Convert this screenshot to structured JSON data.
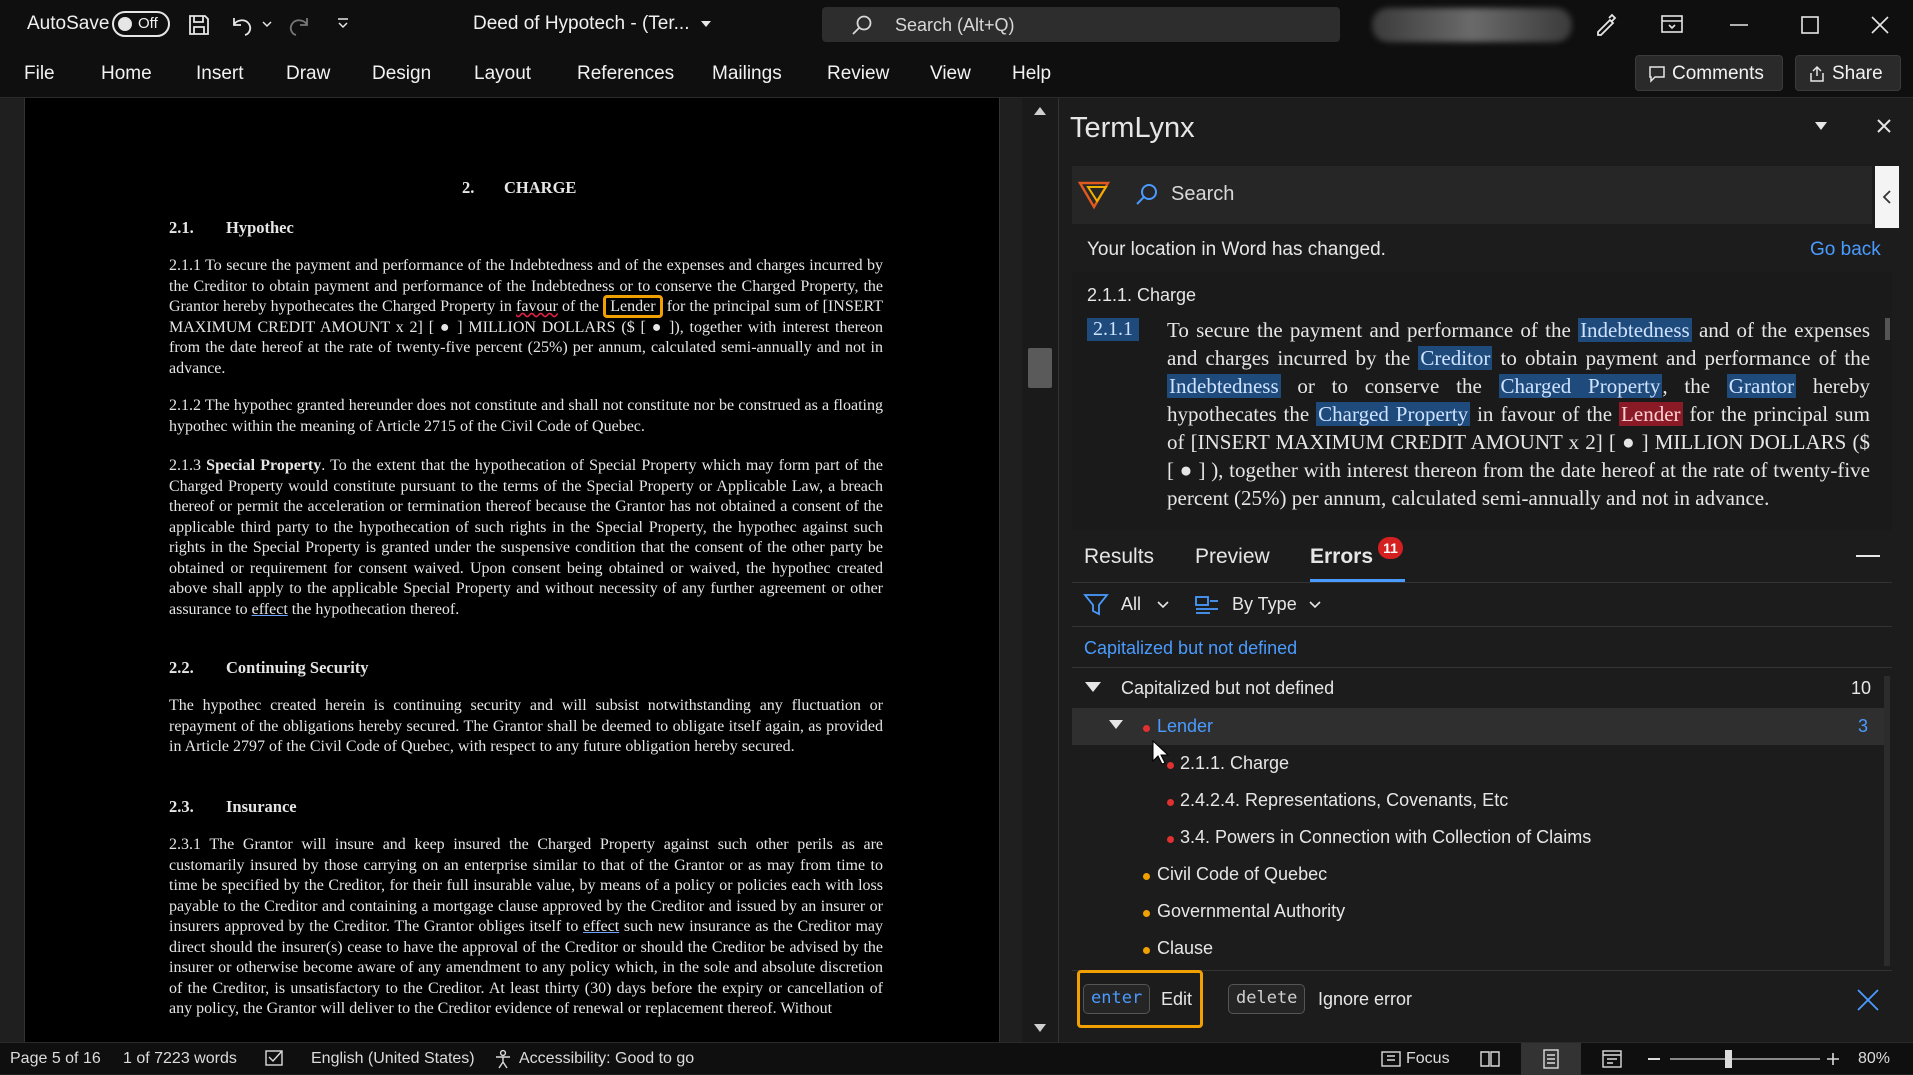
{
  "titlebar": {
    "autosave_label": "AutoSave",
    "autosave_state": "Off",
    "doc_title": "Deed of Hypotech - (Ter...",
    "search_placeholder": "Search (Alt+Q)"
  },
  "ribbon": {
    "tabs": [
      "File",
      "Home",
      "Insert",
      "Draw",
      "Design",
      "Layout",
      "References",
      "Mailings",
      "Review",
      "View",
      "Help"
    ],
    "comments_label": "Comments",
    "share_label": "Share"
  },
  "document": {
    "section_num": "2.",
    "section_title": "CHARGE",
    "h21_num": "2.1.",
    "h21_title": "Hypothec",
    "p211_a": "2.1.1 To secure the payment and performance of the Indebtedness and of the expenses and charges incurred by the Creditor to obtain payment and performance of the Indebtedness or to conserve the Charged Property, the Grantor hereby hypothecates the Charged Property in ",
    "p211_favour": "favour",
    "p211_b": " of the ",
    "p211_lender": "Lender",
    "p211_c": " for the principal sum of [INSERT MAXIMUM CREDIT AMOUNT x 2] [ ● ] MILLION DOLLARS ($ [ ● ]), together with interest thereon from the date hereof at the rate of twenty-five percent (25%) per annum, calculated semi-annually and not in advance.",
    "p212": "2.1.2 The hypothec granted hereunder does not constitute and shall not constitute nor be construed as a floating hypothec within the meaning of Article 2715 of the Civil Code of Quebec.",
    "p213_a": "2.1.3 ",
    "p213_bold": "Special Property",
    "p213_b": ". To the extent that the hypothecation of Special Property which may form part of the Charged Property would constitute pursuant to the terms of the Special Property or Applicable Law, a breach thereof or permit the acceleration or termination thereof because the Grantor has not obtained a consent of the applicable third party to the hypothecation of such rights in the Special Property, the hypothec against such rights in the Special Property is granted under the suspensive condition that the consent of the other party be obtained or requirement for consent waived. Upon consent being obtained or waived, the hypothec created above shall apply to the applicable Special Property and without necessity of any further agreement or other assurance to ",
    "p213_effect": "effect",
    "p213_c": " the hypothecation thereof.",
    "h22_num": "2.2.",
    "h22_title": "Continuing Security",
    "p22": "The hypothec created herein is continuing security and will subsist notwithstanding any fluctuation or repayment of the obligations hereby secured. The Grantor shall be deemed to obligate itself again, as provided in Article 2797 of the Civil Code of Quebec, with respect to any future obligation hereby secured.",
    "h23_num": "2.3.",
    "h23_title": "Insurance",
    "p231_a": "2.3.1 The Grantor will insure and keep insured the Charged Property against such other perils as are customarily insured by those carrying on an enterprise similar to that of the Grantor or as may from time to time be specified by the Creditor, for their full insurable value, by means of a policy or policies each with loss payable to the Creditor and containing a mortgage clause approved by the Creditor and issued by an insurer or insurers approved by the Creditor. The Grantor obliges itself to ",
    "p231_effect": "effect",
    "p231_b": " such new insurance as the Creditor may direct should the insurer(s) cease to have the approval of the Creditor or should the Creditor be advised by the insurer or otherwise become aware of any amendment to any policy which, in the sole and absolute discretion of the Creditor, is unsatisfactory to the Creditor. At least thirty (30) days before the expiry or cancellation of any policy, the Grantor will deliver to the Creditor evidence of renewal or replacement thereof. Without"
  },
  "panel": {
    "title": "TermLynx",
    "search_placeholder": "Search",
    "location_msg": "Your location in Word has changed.",
    "go_back": "Go back",
    "preview_heading": "2.1.1. Charge",
    "preview_num": "2.1.1",
    "preview": {
      "t1": "To secure the payment and performance of the ",
      "k1": "Indebtedness",
      "t2": " and of the expenses and charges incurred by the ",
      "k2": "Creditor",
      "t3": " to obtain payment and performance of the ",
      "k3": "Indebtedness",
      "t4": " or to conserve the ",
      "k4": "Charged Property",
      "t5": ", the ",
      "k5": "Grantor",
      "t6": " hereby hypothecates the ",
      "k6": "Charged Property",
      "t7": " in favour of the ",
      "k7": "Lender",
      "t8": " for the principal sum of [INSERT MAXIMUM CREDIT AMOUNT x 2] [ ● ] MILLION DOLLARS ($ [ ● ] ), together with interest thereon from the date hereof at the rate of twenty-five percent (25%) per annum, calculated semi-annually and not in advance."
    },
    "tabs": {
      "results": "Results",
      "preview": "Preview",
      "errors": "Errors",
      "errors_count": "11"
    },
    "filter_all": "All",
    "group_by": "By Type",
    "category_link": "Capitalized but not defined",
    "group": {
      "label": "Capitalized but not defined",
      "count": "10"
    },
    "item_lender": {
      "label": "Lender",
      "count": "3"
    },
    "sub_items": [
      "2.1.1. Charge",
      "2.4.2.4. Representations, Covenants, Etc",
      "3.4. Powers in Connection with Collection of Claims"
    ],
    "other_items": [
      "Civil Code of Quebec",
      "Governmental Authority",
      "Clause"
    ],
    "action_enter_key": "enter",
    "action_enter_label": "Edit",
    "action_delete_key": "delete",
    "action_delete_label": "Ignore error",
    "colors": {
      "accent": "#4a9bff",
      "error": "#e03030",
      "warn": "#f0a000"
    }
  },
  "status": {
    "page": "Page 5 of 16",
    "words": "1 of 7223 words",
    "language": "English (United States)",
    "accessibility": "Accessibility: Good to go",
    "focus": "Focus",
    "zoom": "80%"
  }
}
